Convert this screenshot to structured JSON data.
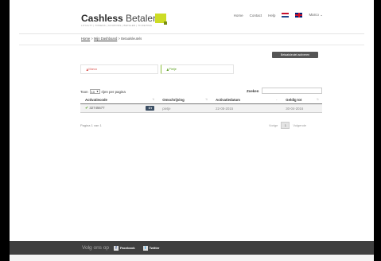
{
  "header": {
    "logo_bold": "Cashless",
    "logo_light": "Betalen",
    "tagline": "LOYALTY | TOKENS | COUPONS | BETALEN | TICKETING",
    "nav": [
      "Home",
      "Contact",
      "Help"
    ],
    "user_label": "Marco",
    "accent_color": "#cddc26"
  },
  "breadcrumb": {
    "items": [
      "Home",
      "Mijn Dashboard"
    ],
    "current": "Betaalsleutels",
    "separator": ">"
  },
  "actions": {
    "activate_label": "Betaalsleutel activeren"
  },
  "cards": [
    {
      "icon": "user-icon",
      "label": "Marco"
    },
    {
      "icon": "user-icon",
      "label": "Pietje"
    }
  ],
  "table_controls": {
    "show_prefix": "Toon",
    "page_size": "10",
    "show_suffix": "rijen per pagina",
    "search_label": "Zoeken",
    "search_value": ""
  },
  "table": {
    "columns": [
      "Activatiecode",
      "Omschrijving",
      "Activatiedatum",
      "Geldig tot"
    ],
    "rows": [
      {
        "code": "32745677",
        "description": "pietje",
        "activation_date": "22-05-2015",
        "valid_until": "30-04-2016"
      }
    ]
  },
  "pagination": {
    "info": "Pagina 1 van 1",
    "prev": "Vorige",
    "current": "1",
    "next": "Volgende"
  },
  "footer": {
    "follow": "Volg ons op",
    "facebook": "Facebook",
    "twitter": "Twitter"
  }
}
